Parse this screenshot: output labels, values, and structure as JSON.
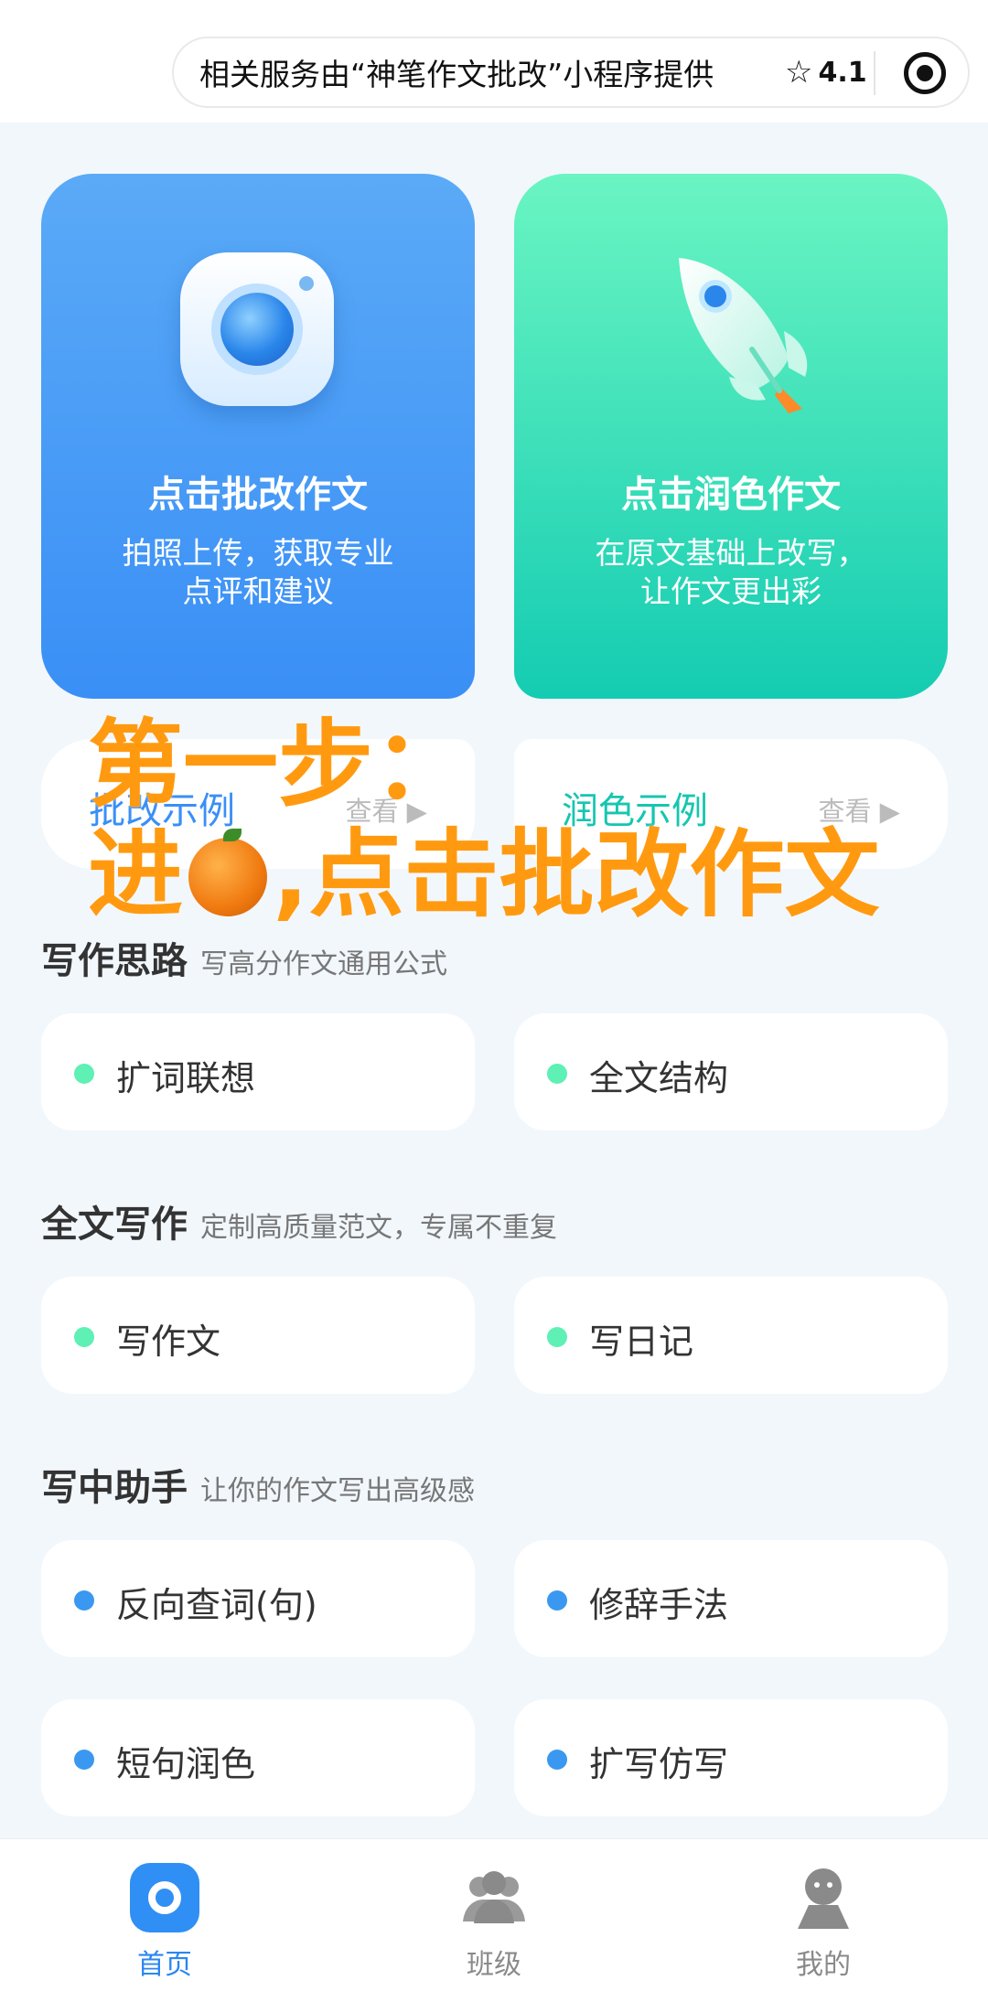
{
  "topbar": {
    "service_text": "相关服务由“神笔作文批改”小程序提供",
    "rating": "4.1"
  },
  "hero": [
    {
      "title": "点击批改作文",
      "desc": "拍照上传，获取专业\n点评和建议"
    },
    {
      "title": "点击润色作文",
      "desc": "在原文基础上改写，\n让作文更出彩"
    }
  ],
  "examples": [
    {
      "title": "批改示例",
      "more": "查看 ▶"
    },
    {
      "title": "润色示例",
      "more": "查看 ▶"
    }
  ],
  "overlay": {
    "line1": "第一步：",
    "line2_pre": "进",
    "line2_post": ",点击批改作文"
  },
  "sections": [
    {
      "title": "写作思路",
      "subtitle": "写高分作文通用公式",
      "items": [
        "扩词联想",
        "全文结构"
      ]
    },
    {
      "title": "全文写作",
      "subtitle": "定制高质量范文，专属不重复",
      "items": [
        "写作文",
        "写日记"
      ]
    },
    {
      "title": "写中助手",
      "subtitle": "让你的作文写出高级感",
      "items": [
        "反向查词(句)",
        "修辞手法",
        "短句润色",
        "扩写仿写"
      ]
    }
  ],
  "tabs": [
    {
      "label": "首页",
      "icon": "home-icon",
      "active": true
    },
    {
      "label": "班级",
      "icon": "class-icon",
      "active": false
    },
    {
      "label": "我的",
      "icon": "profile-icon",
      "active": false
    }
  ],
  "colors": {
    "accent_blue": "#3a8ff6",
    "accent_green": "#16c6b0",
    "overlay_orange": "#ff9a10"
  }
}
